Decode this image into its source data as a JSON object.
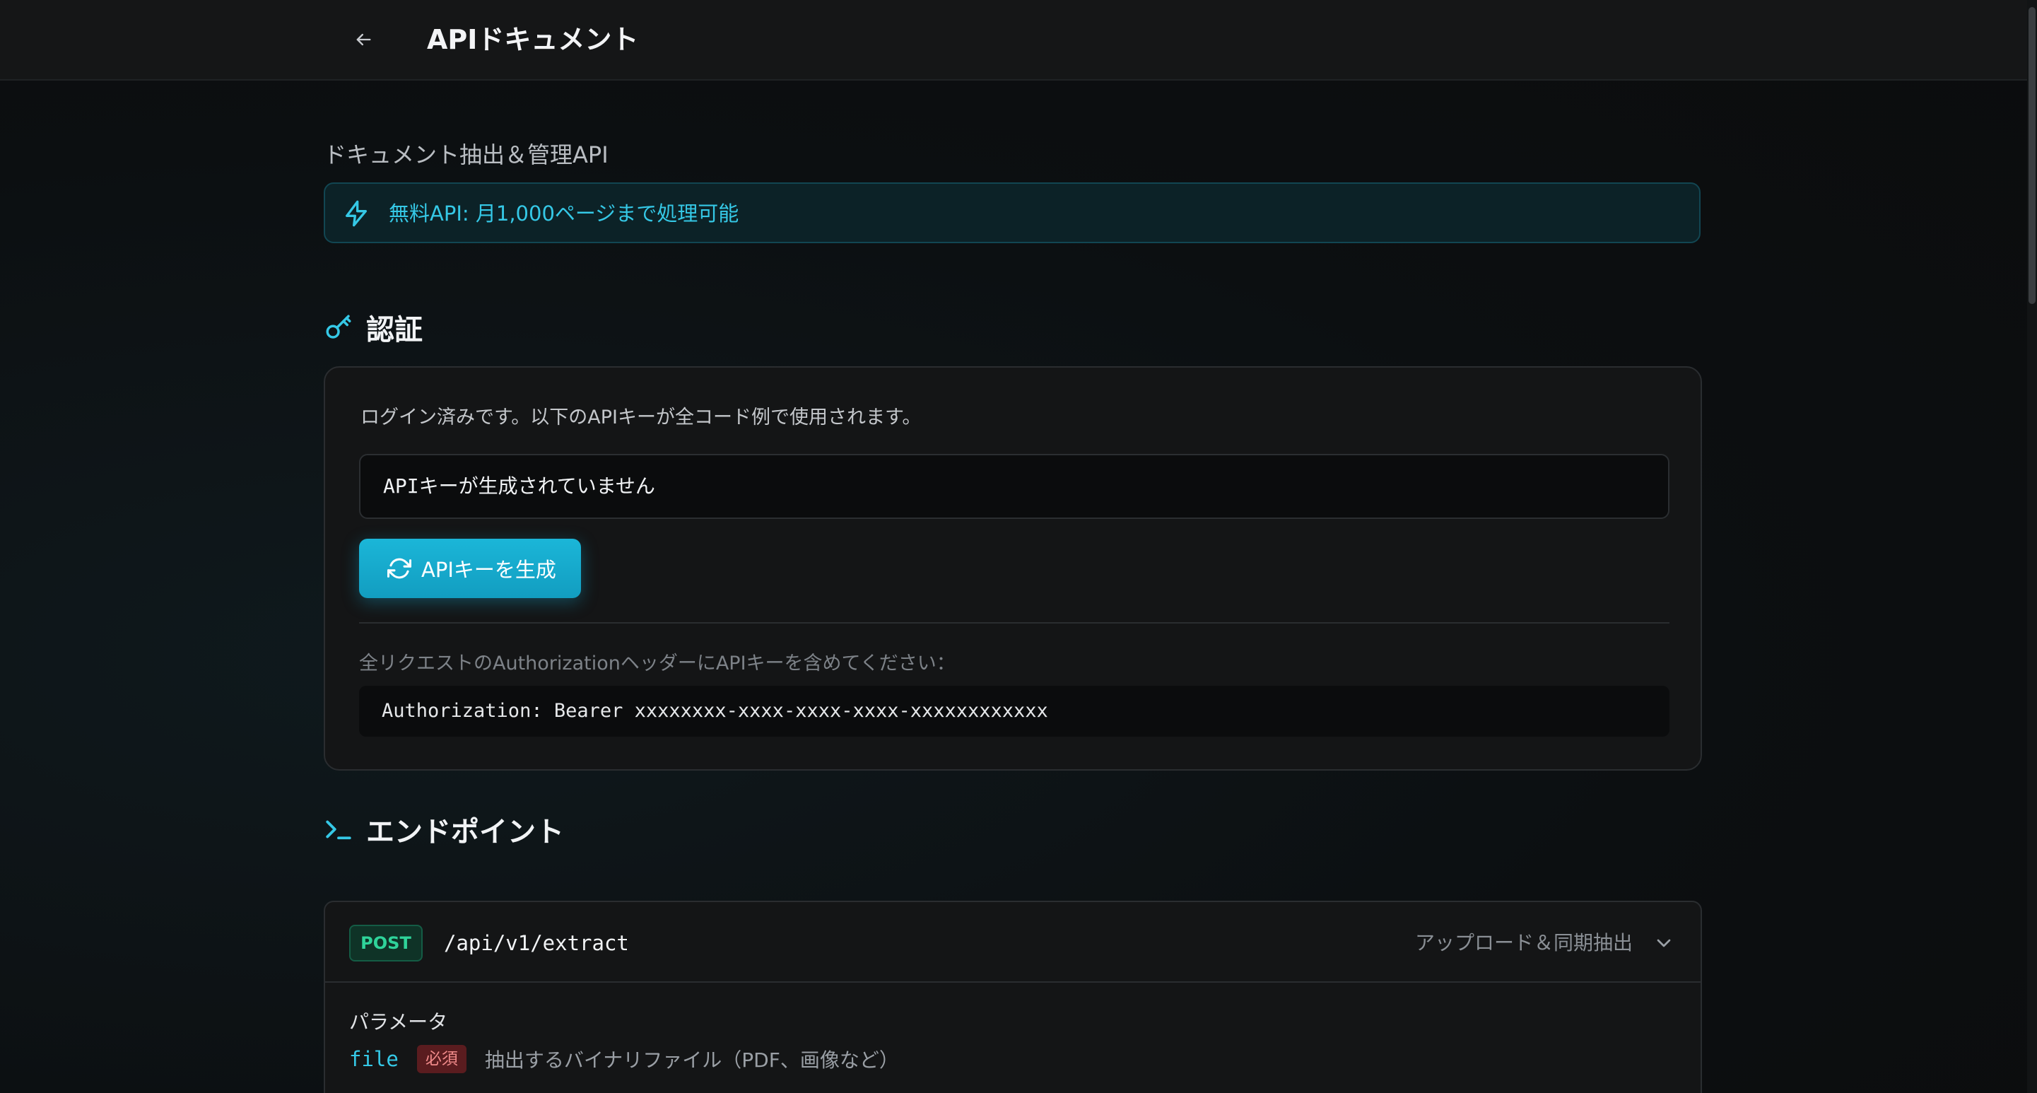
{
  "header": {
    "title": "APIドキュメント",
    "back_icon": "arrow-left-icon"
  },
  "intro": {
    "subtitle": "ドキュメント抽出＆管理API",
    "banner_text": "無料API: 月1,000ページまで処理可能",
    "banner_icon": "lightning-icon"
  },
  "auth": {
    "heading": "認証",
    "heading_icon": "key-icon",
    "description": "ログイン済みです。以下のAPIキーが全コード例で使用されます。",
    "api_key_value": "APIキーが生成されていません",
    "generate_button": "APIキーを生成",
    "generate_icon": "refresh-icon",
    "header_note": "全リクエストのAuthorizationヘッダーにAPIキーを含めてください：",
    "header_example": "Authorization: Bearer xxxxxxxx-xxxx-xxxx-xxxx-xxxxxxxxxxxx"
  },
  "endpoints": {
    "heading": "エンドポイント",
    "heading_icon": "terminal-icon",
    "items": [
      {
        "method": "POST",
        "path": "/api/v1/extract",
        "summary": "アップロード＆同期抽出",
        "params_title": "パラメータ",
        "params": [
          {
            "name": "file",
            "required_label": "必須",
            "description": "抽出するバイナリファイル（PDF、画像など）"
          }
        ]
      }
    ]
  },
  "colors": {
    "accent": "#1bb6d8",
    "accent_text": "#35c8e6",
    "post_green": "#2fd39a",
    "required_red": "#f08a8a",
    "background": "#0d1012"
  }
}
